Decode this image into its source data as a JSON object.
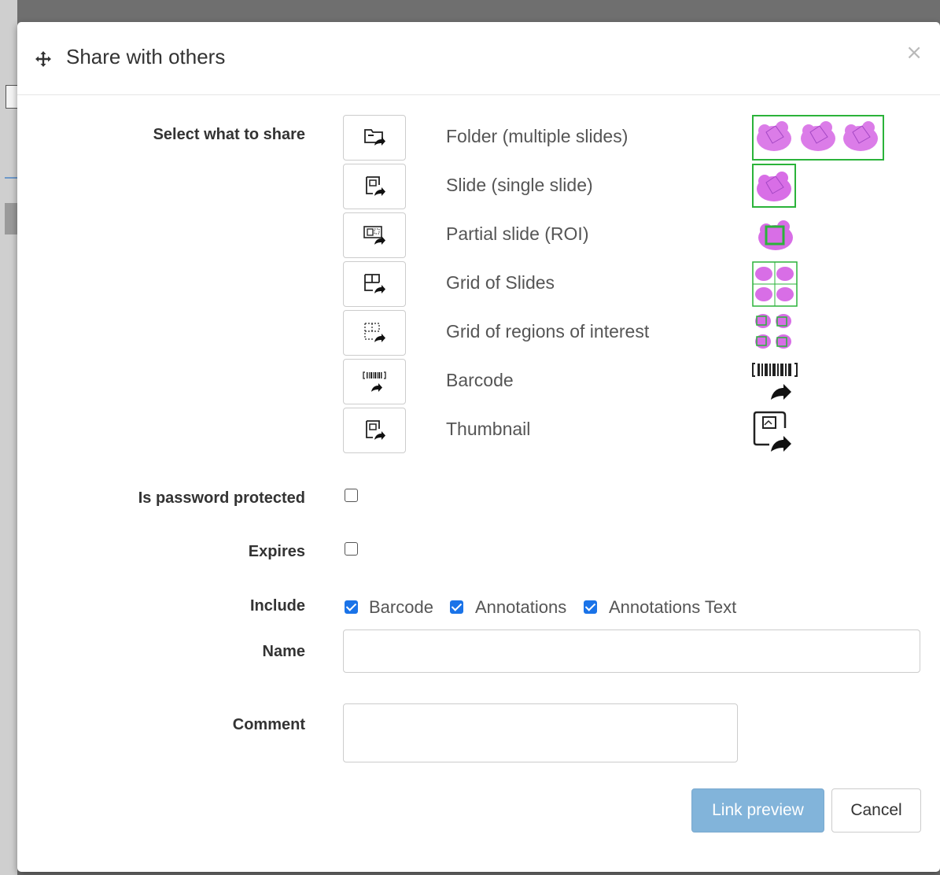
{
  "dialog": {
    "title": "Share with others",
    "close_label": "×"
  },
  "form": {
    "select_label": "Select what to share",
    "options": [
      {
        "label": "Folder (multiple slides)",
        "icon": "folder-share-icon"
      },
      {
        "label": "Slide (single slide)",
        "icon": "slide-share-icon"
      },
      {
        "label": "Partial slide (ROI)",
        "icon": "roi-share-icon"
      },
      {
        "label": "Grid of Slides",
        "icon": "grid-share-icon"
      },
      {
        "label": "Grid of regions of interest",
        "icon": "roi-grid-share-icon"
      },
      {
        "label": "Barcode",
        "icon": "barcode-share-icon"
      },
      {
        "label": "Thumbnail",
        "icon": "thumbnail-share-icon"
      }
    ],
    "password_label": "Is password protected",
    "password_checked": false,
    "expires_label": "Expires",
    "expires_checked": false,
    "include_label": "Include",
    "include_options": [
      {
        "label": "Barcode",
        "checked": true
      },
      {
        "label": "Annotations",
        "checked": true
      },
      {
        "label": "Annotations Text",
        "checked": true
      }
    ],
    "name_label": "Name",
    "name_value": "",
    "comment_label": "Comment",
    "comment_value": ""
  },
  "buttons": {
    "preview": "Link preview",
    "cancel": "Cancel"
  },
  "colors": {
    "preview_border": "#2bb33a",
    "tissue": "#d86ee6",
    "tissue_dark": "#a347c4",
    "primary_button": "#82b4da",
    "checkbox": "#1a73e8"
  }
}
